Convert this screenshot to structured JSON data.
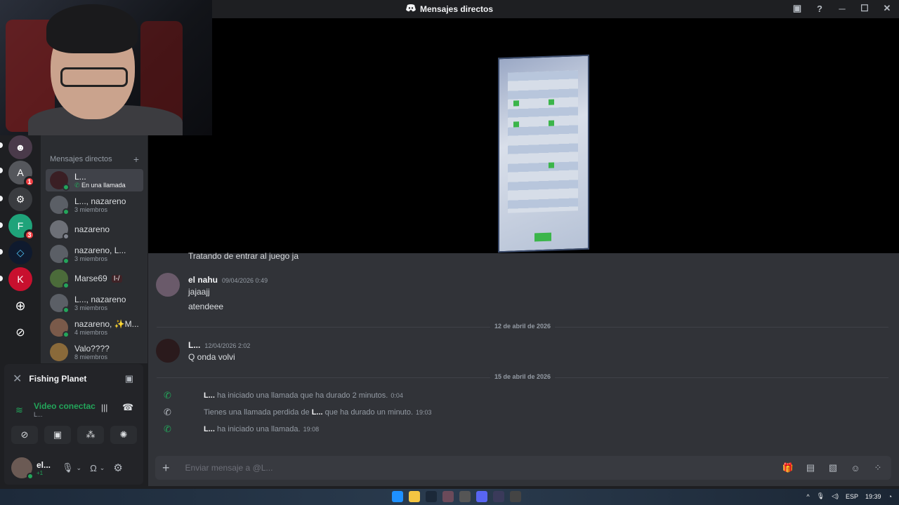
{
  "window": {
    "title": "Mensajes directos"
  },
  "servers": [
    {
      "icon": "avatar-icon",
      "badge": ""
    },
    {
      "icon": "ai-icon",
      "badge": "1"
    },
    {
      "icon": "robot-icon",
      "badge": ""
    },
    {
      "icon": "forza-icon",
      "badge": "3"
    },
    {
      "icon": "diamond-icon",
      "badge": ""
    },
    {
      "icon": "k-icon",
      "badge": ""
    }
  ],
  "sidebar": {
    "header": "Mensajes directos",
    "items": [
      {
        "name": "L...",
        "sub": "En una llamada",
        "active": true
      },
      {
        "name": "L..., nazareno",
        "sub": "3 miembros"
      },
      {
        "name": "nazareno",
        "sub": ""
      },
      {
        "name": "nazareno, L...",
        "sub": "3 miembros"
      },
      {
        "name": "Marse69",
        "sub": "",
        "tag": "I-/"
      },
      {
        "name": "L..., nazareno",
        "sub": "3 miembros"
      },
      {
        "name": "nazareno, ✨M...",
        "sub": "4 miembros"
      },
      {
        "name": "Valo????",
        "sub": "8 miembros"
      }
    ]
  },
  "game": {
    "title": "Fishing Planet"
  },
  "voice": {
    "status": "Video conectac",
    "channel": "L..."
  },
  "user": {
    "name": "el...",
    "status": "+1"
  },
  "messages": [
    {
      "text": "Tratando de entrar al juego ja"
    },
    {
      "author": "el nahu",
      "time": "09/04/2026 0:49",
      "lines": [
        "jajaajj",
        "atendeee"
      ]
    },
    {
      "divider": "12 de abril de 2026"
    },
    {
      "author": "L...",
      "time": "12/04/2026 2:02",
      "lines": [
        "Q onda volvi"
      ]
    },
    {
      "divider": "15 de abril de 2026"
    }
  ],
  "calls": [
    {
      "who": "L...",
      "text": "ha iniciado una llamada que ha durado 2 minutos.",
      "time": "0:04"
    },
    {
      "prefix": "Tienes una llamada perdida de",
      "who": "L...",
      "text": "que ha durado un minuto.",
      "time": "19:03"
    },
    {
      "who": "L...",
      "text": "ha iniciado una llamada.",
      "time": "19:08"
    }
  ],
  "composer": {
    "placeholder": "Enviar mensaje a @L..."
  },
  "taskbar": {
    "lang": "ESP",
    "time": "19:39"
  }
}
